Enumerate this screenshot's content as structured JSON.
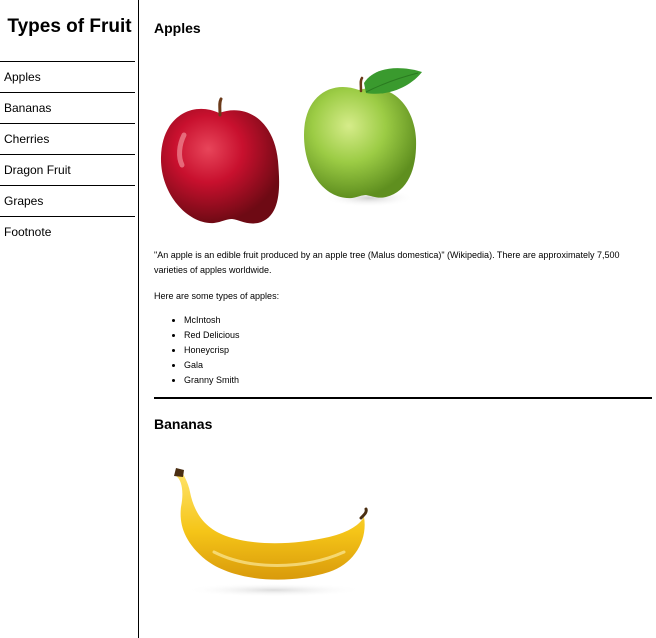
{
  "nav": {
    "title": "Types of Fruit",
    "items": [
      {
        "label": "Apples"
      },
      {
        "label": "Bananas"
      },
      {
        "label": "Cherries"
      },
      {
        "label": "Dragon Fruit"
      },
      {
        "label": "Grapes"
      },
      {
        "label": "Footnote"
      }
    ]
  },
  "apples": {
    "title": "Apples",
    "quote": "\"An apple is an edible fruit produced by an apple tree (Malus domestica)\" (Wikipedia). There are approximately 7,500 varieties of apples worldwide.",
    "types_intro": "Here are some types of apples:",
    "types": [
      "McIntosh",
      "Red Delicious",
      "Honeycrisp",
      "Gala",
      "Granny Smith"
    ]
  },
  "bananas": {
    "title": "Bananas"
  },
  "colors": {
    "red_apple": "#c8102e",
    "green_apple": "#8cc63f",
    "banana": "#f5c518",
    "leaf": "#3a9a2e"
  }
}
